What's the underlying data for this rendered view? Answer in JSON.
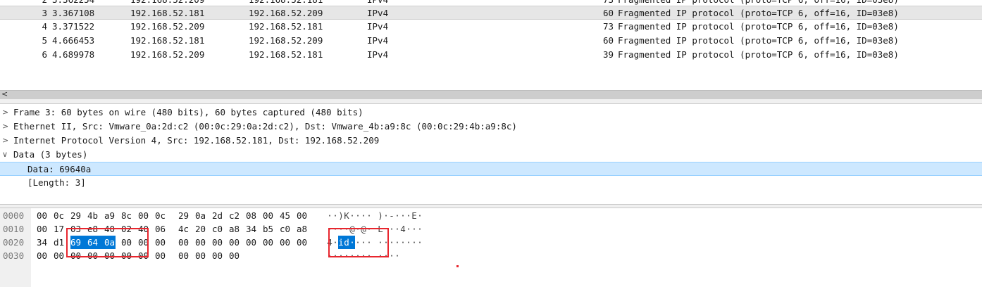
{
  "packet_list": {
    "partial_top_row": {
      "no": "2",
      "time": "3.362254",
      "src": "192.168.52.209",
      "dst": "192.168.52.181",
      "protocol": "IPv4",
      "length": "73",
      "info": "Fragmented IP protocol (proto=TCP 6, off=16, ID=03e8)"
    },
    "rows": [
      {
        "no": "3",
        "time": "3.367108",
        "src": "192.168.52.181",
        "dst": "192.168.52.209",
        "protocol": "IPv4",
        "length": "60",
        "info": "Fragmented IP protocol (proto=TCP 6, off=16, ID=03e8)",
        "selected": true
      },
      {
        "no": "4",
        "time": "3.371522",
        "src": "192.168.52.209",
        "dst": "192.168.52.181",
        "protocol": "IPv4",
        "length": "73",
        "info": "Fragmented IP protocol (proto=TCP 6, off=16, ID=03e8)"
      },
      {
        "no": "5",
        "time": "4.666453",
        "src": "192.168.52.181",
        "dst": "192.168.52.209",
        "protocol": "IPv4",
        "length": "60",
        "info": "Fragmented IP protocol (proto=TCP 6, off=16, ID=03e8)"
      },
      {
        "no": "6",
        "time": "4.689978",
        "src": "192.168.52.209",
        "dst": "192.168.52.181",
        "protocol": "IPv4",
        "length": "39",
        "info": "Fragmented IP protocol (proto=TCP 6, off=16, ID=03e8)"
      }
    ]
  },
  "scrollbar": {
    "left_arrow": "<"
  },
  "details": {
    "frame": "Frame 3: 60 bytes on wire (480 bits), 60 bytes captured (480 bits)",
    "ethernet": "Ethernet II, Src: Vmware_0a:2d:c2 (00:0c:29:0a:2d:c2), Dst: Vmware_4b:a9:8c (00:0c:29:4b:a9:8c)",
    "ip": "Internet Protocol Version 4, Src: 192.168.52.181, Dst: 192.168.52.209",
    "data": "Data (3 bytes)",
    "data_value": "Data: 69640a",
    "data_length": "[Length: 3]",
    "collapsed_arrow": ">",
    "expanded_arrow": "∨"
  },
  "bytes": {
    "rows": [
      {
        "offset": "0000",
        "hex": [
          "00",
          "0c",
          "29",
          "4b",
          "a9",
          "8c",
          "00",
          "0c",
          "29",
          "0a",
          "2d",
          "c2",
          "08",
          "00",
          "45",
          "00"
        ],
        "ascii": [
          "·",
          "·",
          ")",
          "K",
          "·",
          "·",
          "·",
          "·",
          ")",
          "·",
          "-",
          "·",
          "·",
          "·",
          "E",
          "·"
        ]
      },
      {
        "offset": "0010",
        "hex": [
          "00",
          "17",
          "03",
          "e8",
          "40",
          "02",
          "40",
          "06",
          "4c",
          "20",
          "c0",
          "a8",
          "34",
          "b5",
          "c0",
          "a8"
        ],
        "ascii": [
          "·",
          "·",
          "·",
          "·",
          "@",
          "·",
          "@",
          "·",
          "L",
          " ",
          "·",
          "·",
          "4",
          "·",
          "·",
          "·"
        ]
      },
      {
        "offset": "0020",
        "hex": [
          "34",
          "d1",
          "69",
          "64",
          "0a",
          "00",
          "00",
          "00",
          "00",
          "00",
          "00",
          "00",
          "00",
          "00",
          "00",
          "00"
        ],
        "ascii": [
          "4",
          "·",
          "i",
          "d",
          "·",
          "·",
          "·",
          "·",
          "·",
          "·",
          "·",
          "·",
          "·",
          "·",
          "·",
          "·"
        ]
      },
      {
        "offset": "0030",
        "hex": [
          "00",
          "00",
          "00",
          "00",
          "00",
          "00",
          "00",
          "00",
          "00",
          "00",
          "00",
          "00"
        ],
        "ascii": [
          "·",
          "·",
          "·",
          "·",
          "·",
          "·",
          "·",
          "·",
          "·",
          "·",
          "·",
          "·"
        ]
      }
    ],
    "highlight": {
      "row": 2,
      "start": 2,
      "end": 4
    }
  },
  "colors": {
    "selection": "#0078d7",
    "tree_selection": "#cde8ff",
    "annotation_red": "#e8262e"
  }
}
